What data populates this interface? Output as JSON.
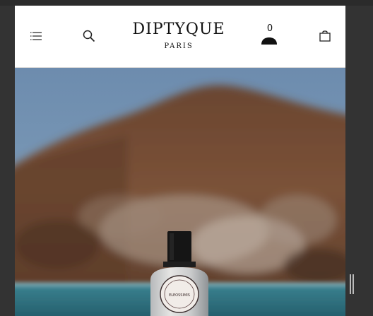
{
  "header": {
    "brand_name": "DIPTYQUE",
    "brand_city": "PARIS",
    "account_count": "0"
  },
  "icons": {
    "menu": "hamburger-menu-icon",
    "search": "search-icon",
    "account": "user-icon",
    "bag": "shopping-bag-icon"
  },
  "hero": {
    "bottle_label": "ELEOSSIMIS"
  },
  "colors": {
    "sky": "#5f7fa0",
    "hill": "#7a5033",
    "sea": "#2f6e7a",
    "frame": "#333333"
  }
}
